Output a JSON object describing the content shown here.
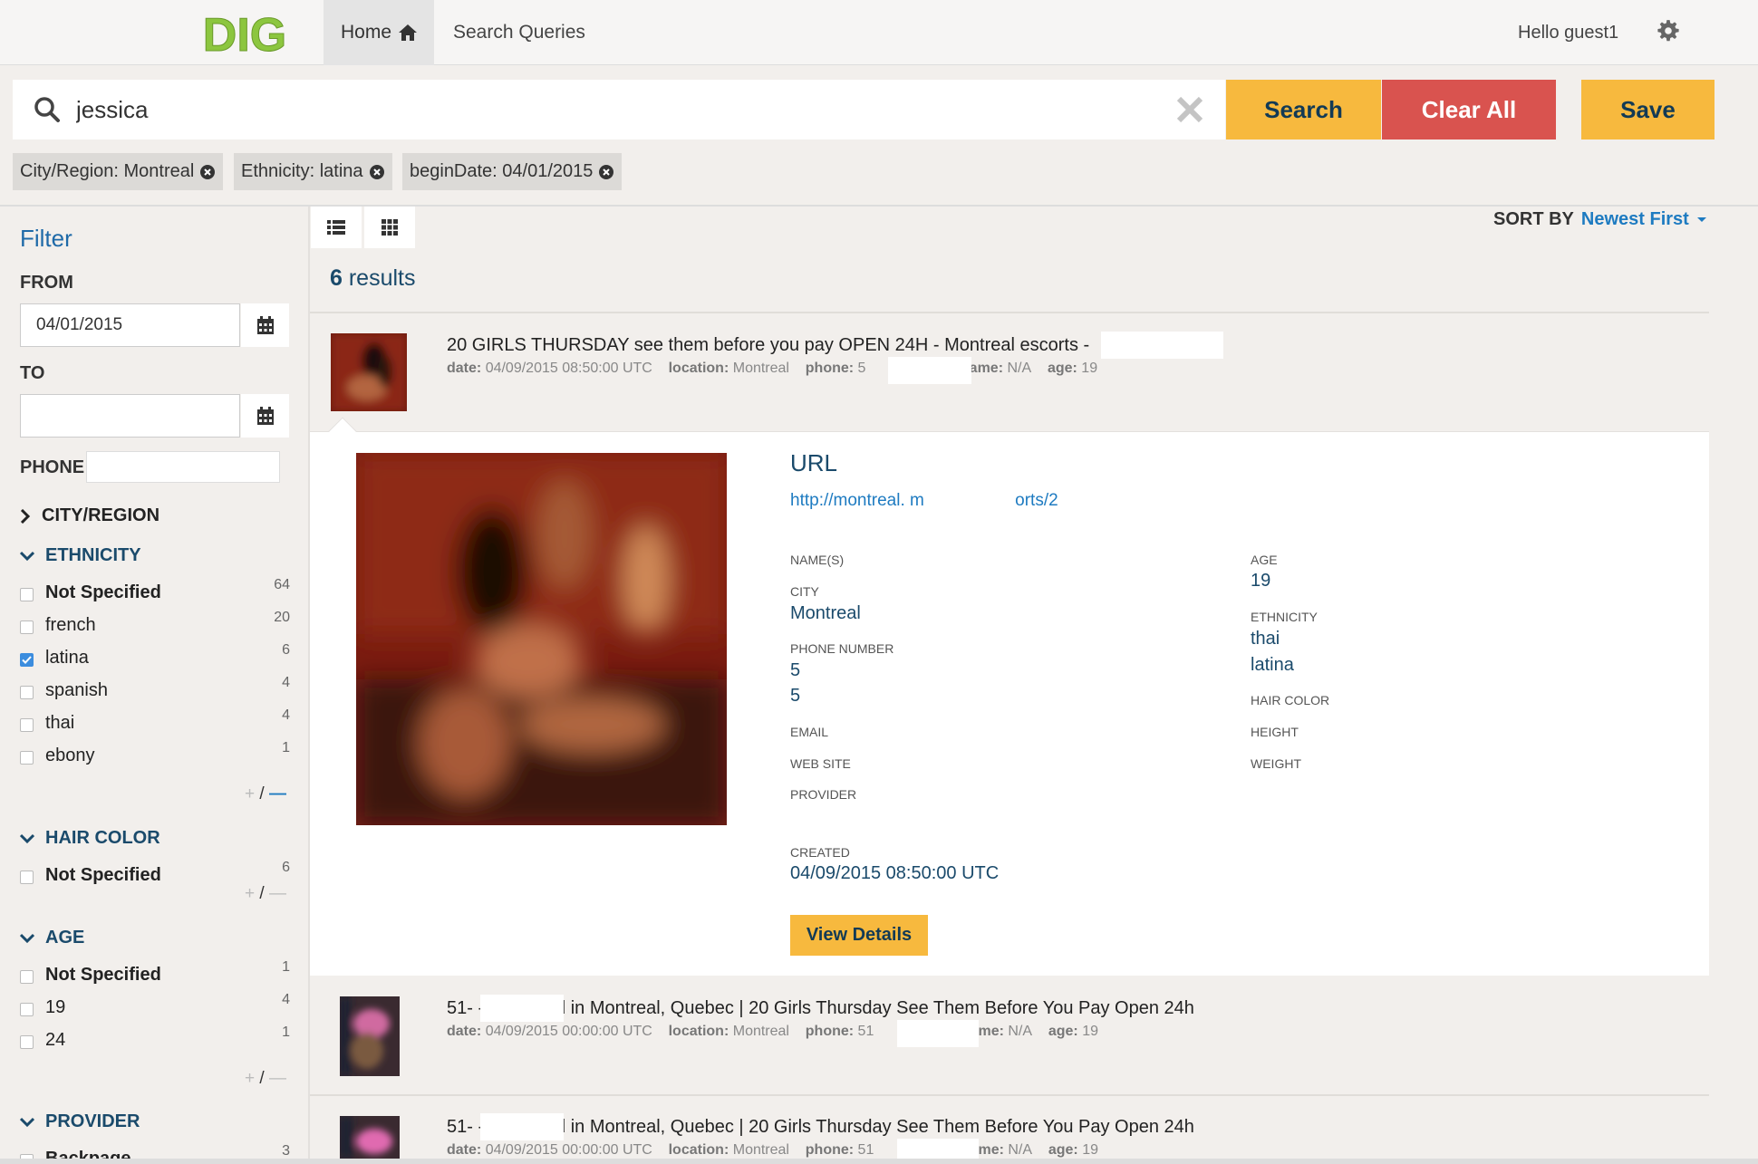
{
  "nav": {
    "logo_text": "DIG",
    "home": "Home",
    "search_queries": "Search Queries",
    "greeting": "Hello guest1"
  },
  "search": {
    "query": "jessica",
    "search_label": "Search",
    "clear_all_label": "Clear All",
    "save_label": "Save"
  },
  "chips": [
    "City/Region: Montreal",
    "Ethnicity: latina",
    "beginDate: 04/01/2015"
  ],
  "filter": {
    "title": "Filter",
    "from_label": "FROM",
    "from_value": "04/01/2015",
    "to_label": "TO",
    "to_value": "",
    "phone_label": "PHONE",
    "city_label": "CITY/REGION",
    "ethnicity": {
      "label": "ETHNICITY",
      "items": [
        {
          "label": "Not Specified",
          "count": "64",
          "checked": false
        },
        {
          "label": "french",
          "count": "20",
          "checked": false
        },
        {
          "label": "latina",
          "count": "6",
          "checked": true
        },
        {
          "label": "spanish",
          "count": "4",
          "checked": false
        },
        {
          "label": "thai",
          "count": "4",
          "checked": false
        },
        {
          "label": "ebony",
          "count": "1",
          "checked": false
        }
      ]
    },
    "hair": {
      "label": "HAIR COLOR",
      "items": [
        {
          "label": "Not Specified",
          "count": "6"
        }
      ]
    },
    "age": {
      "label": "AGE",
      "items": [
        {
          "label": "Not Specified",
          "count": "1"
        },
        {
          "label": "19",
          "count": "4"
        },
        {
          "label": "24",
          "count": "1"
        }
      ]
    },
    "provider": {
      "label": "PROVIDER",
      "items": [
        {
          "label": "Backpage",
          "count": "3"
        }
      ]
    }
  },
  "toolbar": {
    "sort_label": "SORT BY",
    "sort_value": "Newest First",
    "results_count": "6",
    "results_word": "results"
  },
  "items": [
    {
      "title": "20 GIRLS THURSDAY see them before you pay OPEN 24H - Montreal escorts - ",
      "date_label": "date:",
      "date": "04/09/2015 08:50:00 UTC",
      "location_label": "location:",
      "location": "Montreal",
      "phone_label": "phone:",
      "phone": "5",
      "name_label": "name:",
      "name": "N/A",
      "age_label": "age:",
      "age": "19"
    },
    {
      "title": "51-          - Escort ad in Montreal, Quebec | 20 Girls Thursday See Them Before You Pay Open 24h",
      "date_label": "date:",
      "date": "04/09/2015 00:00:00 UTC",
      "location_label": "location:",
      "location": "Montreal",
      "phone_label": "phone:",
      "phone": "51",
      "name_label": "name:",
      "name": "N/A",
      "age_label": "age:",
      "age": "19"
    },
    {
      "title": "51-          - Escort ad in Montreal, Quebec | 20 Girls Thursday See Them Before You Pay Open 24h",
      "date_label": "date:",
      "date": "04/09/2015 00:00:00 UTC",
      "location_label": "location:",
      "location": "Montreal",
      "phone_label": "phone:",
      "phone": "51",
      "name_label": "name:",
      "name": "N/A",
      "age_label": "age:",
      "age": "19"
    }
  ],
  "detail": {
    "url_heading": "URL",
    "url_text": "http://montreal.                    m/FemaleEscorts/2",
    "names_label": "NAME(S)",
    "city_label": "CITY",
    "city_value": "Montreal",
    "phone_label": "PHONE NUMBER",
    "phone_1": "5",
    "phone_2": "5",
    "email_label": "EMAIL",
    "website_label": "WEB SITE",
    "provider_label": "PROVIDER",
    "age_label": "AGE",
    "age_value": "19",
    "ethnicity_label": "ETHNICITY",
    "ethnicity_1": "thai",
    "ethnicity_2": "latina",
    "hair_label": "HAIR COLOR",
    "height_label": "HEIGHT",
    "weight_label": "WEIGHT",
    "created_label": "CREATED",
    "created_value": "04/09/2015 08:50:00 UTC",
    "view_details": "View Details"
  },
  "colors": {
    "accent_yellow": "#f7b93e",
    "danger_red": "#d9534f",
    "link_blue": "#1e7bc1",
    "dark_blue": "#1a4a6b",
    "logo_green": "#8cc63f"
  }
}
